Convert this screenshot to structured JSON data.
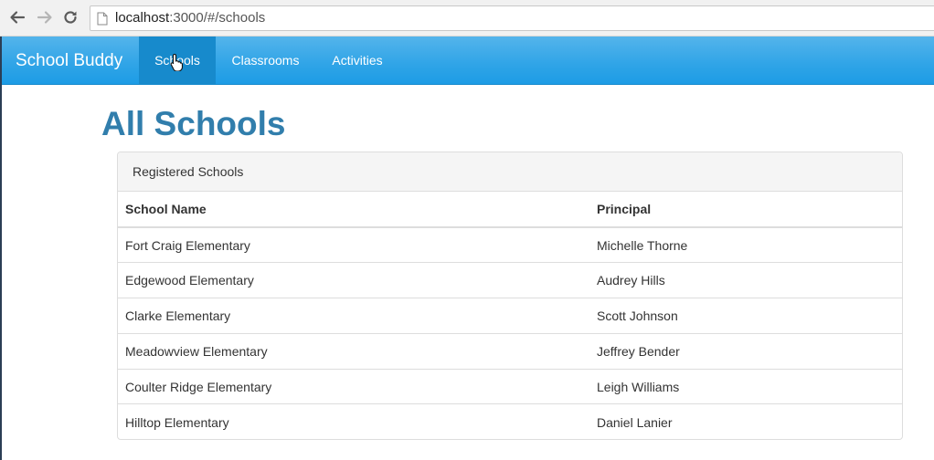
{
  "browser": {
    "url_host": "localhost",
    "url_path": ":3000/#/schools"
  },
  "navbar": {
    "brand": "School Buddy",
    "items": [
      {
        "label": "Schools",
        "active": true
      },
      {
        "label": "Classrooms",
        "active": false
      },
      {
        "label": "Activities",
        "active": false
      }
    ]
  },
  "page": {
    "title": "All Schools"
  },
  "panel": {
    "heading": "Registered Schools",
    "columns": [
      "School Name",
      "Principal"
    ],
    "rows": [
      [
        "Fort Craig Elementary",
        "Michelle Thorne"
      ],
      [
        "Edgewood Elementary",
        "Audrey Hills"
      ],
      [
        "Clarke Elementary",
        "Scott Johnson"
      ],
      [
        "Meadowview Elementary",
        "Jeffrey Bender"
      ],
      [
        "Coulter Ridge Elementary",
        "Leigh Williams"
      ],
      [
        "Hilltop Elementary",
        "Daniel Lanier"
      ]
    ]
  },
  "colors": {
    "navbar": "#2fa4e7",
    "navbar_active": "#178acc",
    "title": "#317eac"
  },
  "icons": [
    "back-arrow-icon",
    "forward-arrow-icon",
    "reload-icon",
    "page-icon",
    "hand-cursor-icon"
  ]
}
